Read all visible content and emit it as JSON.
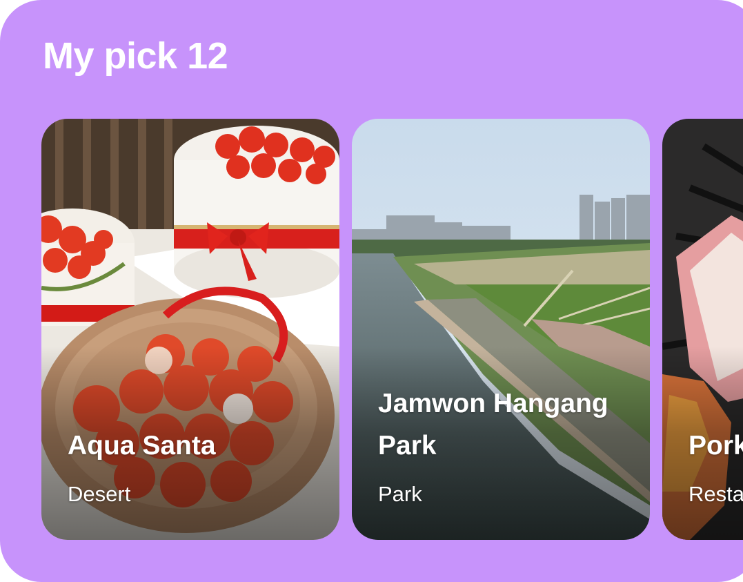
{
  "section": {
    "title": "My pick 12"
  },
  "cards": [
    {
      "name": "Aqua Santa",
      "category": "Desert",
      "image": "strawberry-christmas-cakes"
    },
    {
      "name": "Jamwon Hangang Park",
      "category": "Park",
      "image": "river-park-aerial"
    },
    {
      "name": "Pork",
      "category": "Restaurant",
      "image": "grilled-pork-belly"
    }
  ],
  "colors": {
    "panel_background": "#c793fb",
    "text": "#ffffff"
  }
}
